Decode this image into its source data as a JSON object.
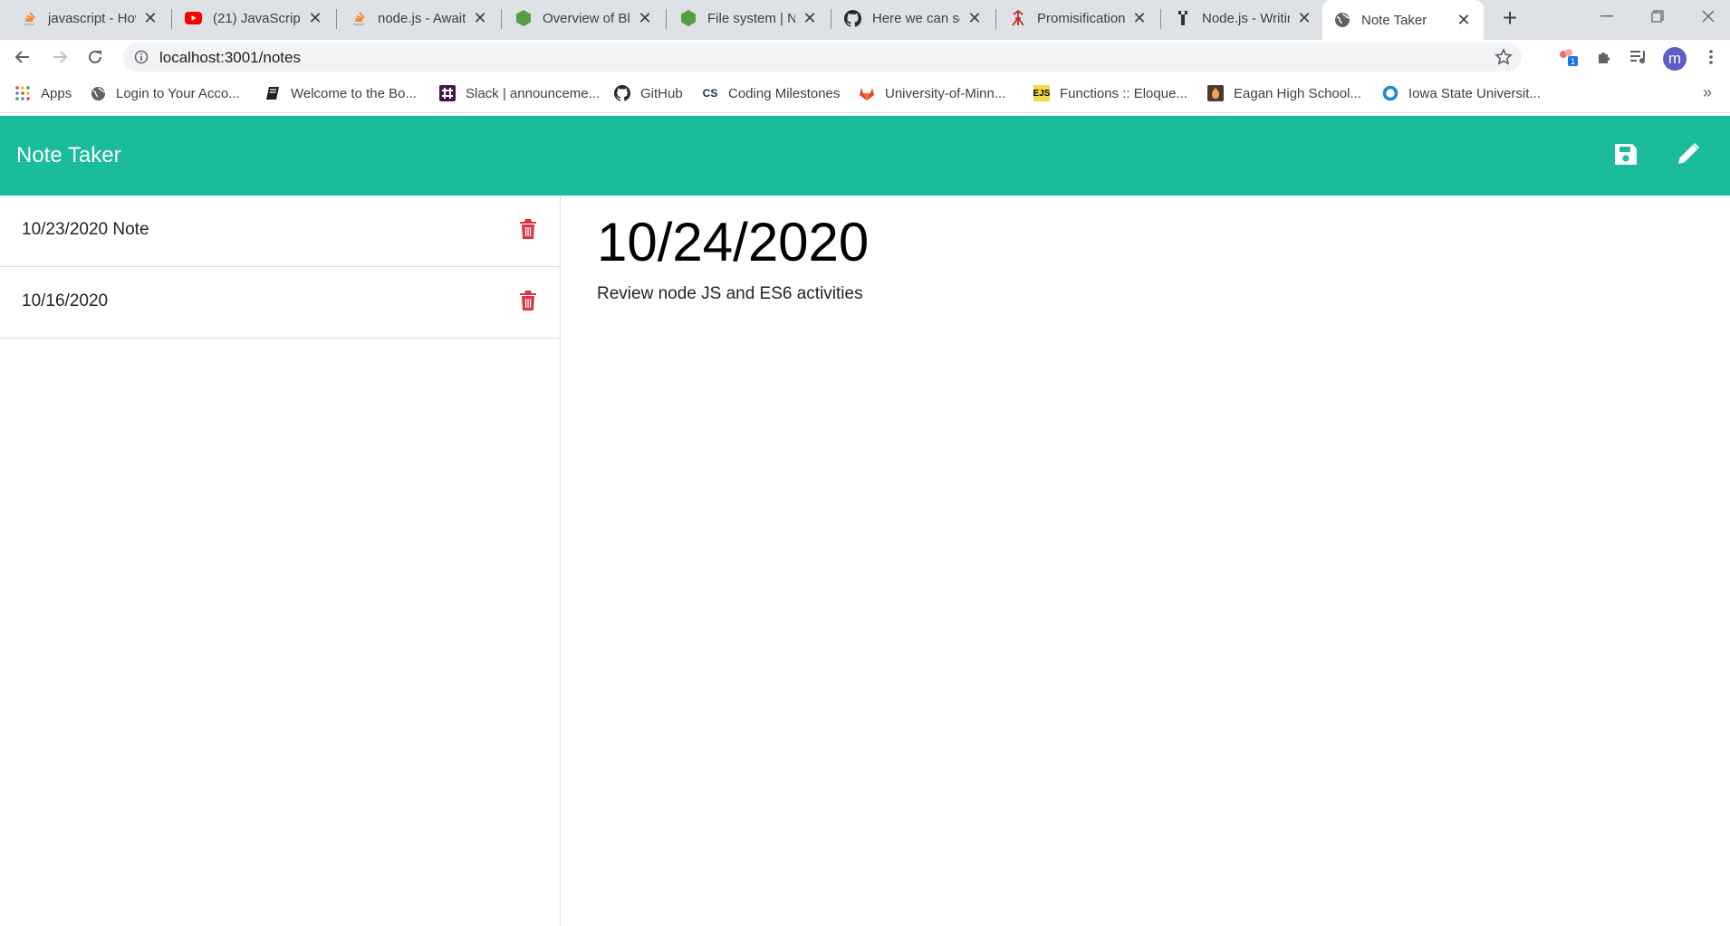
{
  "browser": {
    "tabs": [
      {
        "title": "javascript - How",
        "icon": "stackoverflow-icon",
        "active": false
      },
      {
        "title": "(21) JavaScript",
        "icon": "youtube-icon",
        "active": false
      },
      {
        "title": "node.js - Await",
        "icon": "stackoverflow-icon",
        "active": false
      },
      {
        "title": "Overview of Blo",
        "icon": "nodejs-icon",
        "active": false
      },
      {
        "title": "File system | No",
        "icon": "nodejs-icon",
        "active": false
      },
      {
        "title": "Here we can se",
        "icon": "github-icon",
        "active": false
      },
      {
        "title": "Promisification",
        "icon": "javascript-info-icon",
        "active": false
      },
      {
        "title": "Node.js - Writin",
        "icon": "tutorialspoint-icon",
        "active": false
      },
      {
        "title": "Note Taker",
        "icon": "globe-icon",
        "active": true
      }
    ],
    "url": "localhost:3001/notes",
    "profile_initial": "m",
    "extension_badge": "1",
    "bookmarks": [
      {
        "label": "Apps",
        "icon": "apps-grid-icon"
      },
      {
        "label": "Login to Your Acco...",
        "icon": "globe-icon"
      },
      {
        "label": "Welcome to the Bo...",
        "icon": "book-icon"
      },
      {
        "label": "Slack | announceme...",
        "icon": "slack-icon"
      },
      {
        "label": "GitHub",
        "icon": "github-icon"
      },
      {
        "label": "Coding Milestones",
        "icon": "cs-icon"
      },
      {
        "label": "University-of-Minn...",
        "icon": "gitlab-icon"
      },
      {
        "label": "Functions :: Eloque...",
        "icon": "ejs-icon"
      },
      {
        "label": "Eagan High School...",
        "icon": "school-icon"
      },
      {
        "label": "Iowa State Universit...",
        "icon": "ring-icon"
      }
    ],
    "bookmarks_overflow": "»",
    "cs_glyph": "CS",
    "ejs_glyph": "EJS"
  },
  "app": {
    "title": "Note Taker",
    "accent": "#1abc9c",
    "delete_color": "#dc3545",
    "notes": [
      {
        "title": "10/23/2020 Note"
      },
      {
        "title": "10/16/2020"
      }
    ],
    "active_note": {
      "title": "10/24/2020",
      "text": "Review node JS and ES6 activities"
    }
  }
}
